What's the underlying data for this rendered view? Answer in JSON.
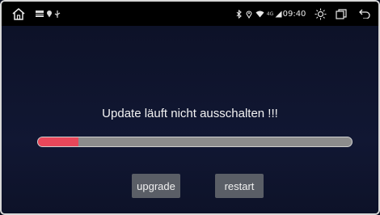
{
  "statusbar": {
    "icons_left": [
      "home-icon",
      "notification-icon",
      "usb-icon"
    ],
    "network_label": "4G",
    "time": "09:40",
    "icons_right": [
      "bluetooth-icon",
      "location-icon",
      "wifi-icon",
      "signal-icon",
      "brightness-icon",
      "recent-apps-icon",
      "back-icon"
    ]
  },
  "update": {
    "message": "Update läuft nicht ausschalten !!!",
    "progress_fraction": 0.13,
    "progress_color": "#e8475a"
  },
  "buttons": {
    "upgrade_label": "upgrade",
    "restart_label": "restart"
  }
}
